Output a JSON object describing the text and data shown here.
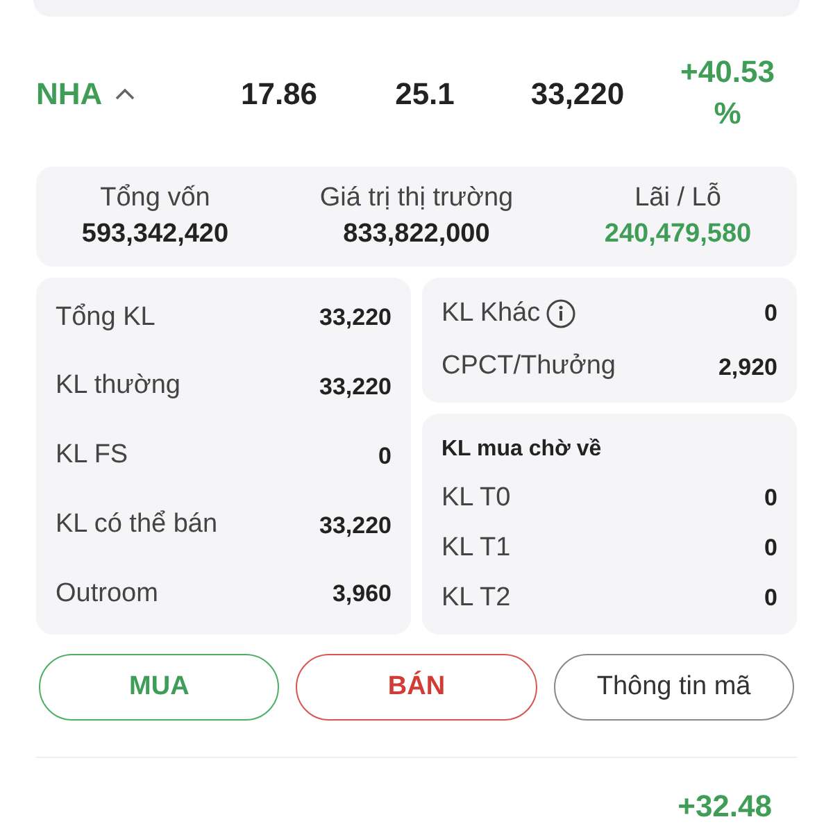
{
  "holding": {
    "symbol": "NHA",
    "expanded": true,
    "avg_price": "17.86",
    "market_price": "25.1",
    "volume": "33,220",
    "change_lines": [
      "+40.53",
      "%"
    ]
  },
  "summary": [
    {
      "label": "Tổng vốn",
      "value": "593,342,420",
      "kind": "plain"
    },
    {
      "label": "Giá trị thị trường",
      "value": "833,822,000",
      "kind": "plain"
    },
    {
      "label": "Lãi / Lỗ",
      "value": "240,479,580",
      "kind": "gain"
    }
  ],
  "volumes": [
    {
      "label": "Tổng KL",
      "value": "33,220"
    },
    {
      "label": "KL thường",
      "value": "33,220"
    },
    {
      "label": "KL FS",
      "value": "0"
    },
    {
      "label": "KL có thể bán",
      "value": "33,220"
    },
    {
      "label": "Outroom",
      "value": "3,960"
    }
  ],
  "other": [
    {
      "label": "KL Khác",
      "value": "0",
      "info": true
    },
    {
      "label": "CPCT/Thưởng",
      "value": "2,920",
      "info": false
    }
  ],
  "pending": {
    "title": "KL mua chờ về",
    "rows": [
      {
        "label": "KL T0",
        "value": "0"
      },
      {
        "label": "KL T1",
        "value": "0"
      },
      {
        "label": "KL T2",
        "value": "0"
      }
    ]
  },
  "buttons": [
    {
      "label": "MUA",
      "kind": "buy"
    },
    {
      "label": "BÁN",
      "kind": "sell"
    },
    {
      "label": "Thông tin mã",
      "kind": "info"
    }
  ],
  "next_row": {
    "change": "+32.48"
  }
}
